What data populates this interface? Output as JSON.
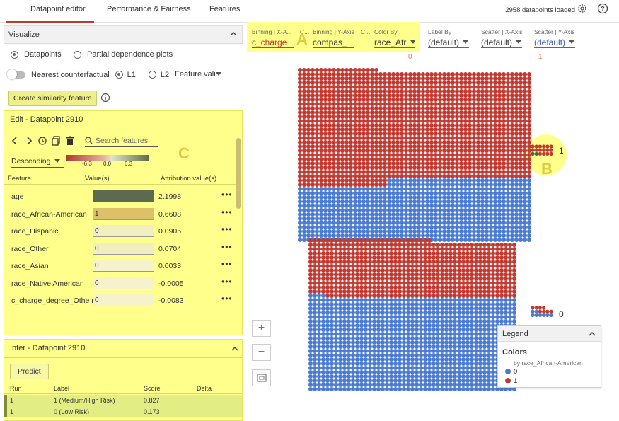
{
  "tabs": [
    {
      "label": "Datapoint editor"
    },
    {
      "label": "Performance & Fairness"
    },
    {
      "label": "Features"
    }
  ],
  "datapoints_loaded": "2958 datapoints loaded",
  "visualize": {
    "title": "Visualize",
    "datapoints_label": "Datapoints",
    "pdp_label": "Partial dependence plots",
    "nearest_cf_label": "Nearest counterfactual",
    "l1_label": "L1",
    "l2_label": "L2",
    "feature_select_value": "Feature valu",
    "create_button": "Create similarity feature"
  },
  "edit": {
    "title": "Edit - Datapoint 2910",
    "search_placeholder": "Search features",
    "sort_value": "Descending",
    "scale_labels": [
      "-6.3",
      "0.0",
      "6.3"
    ],
    "col_feature": "Feature",
    "col_values": "Value(s)",
    "col_attribution": "Attribution value(s)",
    "rows": [
      {
        "name": "age",
        "value": "",
        "attr": "2.1998",
        "bar": 1.0,
        "barcolor": "#5c6b4e"
      },
      {
        "name": "race_African-American",
        "value": "1",
        "attr": "0.6608",
        "bar": 1.0,
        "barcolor": "#dcc06a"
      },
      {
        "name": "race_Hispanic",
        "value": "0",
        "attr": "0.0905",
        "bar": 1.0,
        "barcolor": "#f3eec0"
      },
      {
        "name": "race_Other",
        "value": "0",
        "attr": "0.0704",
        "bar": 1.0,
        "barcolor": "#f3eec0"
      },
      {
        "name": "race_Asian",
        "value": "0",
        "attr": "0.0033",
        "bar": 1.0,
        "barcolor": "#f6f2cc"
      },
      {
        "name": "race_Native American",
        "value": "0",
        "attr": "-0.0005",
        "bar": 1.0,
        "barcolor": "#f6f2cc"
      },
      {
        "name": "c_charge_degree_Othe r",
        "value": "0",
        "attr": "-0.0083",
        "bar": 1.0,
        "barcolor": "#f6f2cc"
      }
    ],
    "more_glyph": "•••"
  },
  "infer": {
    "title": "Infer - Datapoint 2910",
    "predict_button": "Predict",
    "columns": [
      "Run",
      "Label",
      "Score",
      "Delta"
    ],
    "rows": [
      {
        "run": "1",
        "label": "1 (Medium/High Risk)",
        "score": "0.827",
        "delta": ""
      },
      {
        "run": "1",
        "label": "0 (Low Risk)",
        "score": "0.173",
        "delta": ""
      }
    ]
  },
  "axes": {
    "binning_x": {
      "label": "Binning | X-A...",
      "value": "c_charge"
    },
    "c1": {
      "label": "C..."
    },
    "binning_y": {
      "label": "Binning | Y-Axis",
      "value": "compas_"
    },
    "c2": {
      "label": "C..."
    },
    "color_by": {
      "label": "Color By",
      "value": "race_Afr"
    },
    "label_by": {
      "label": "Label By",
      "value": "(default)"
    },
    "scatter_x": {
      "label": "Scatter | X-Axis",
      "value": "(default)"
    },
    "scatter_y": {
      "label": "Scatter | Y-Axis",
      "value": "(default)"
    }
  },
  "markers": {
    "a": "A",
    "b": "B",
    "c": "C",
    "sort_zero": "0",
    "sort_one": "1"
  },
  "bins": {
    "label_1": "1",
    "label_0": "0"
  },
  "legend": {
    "title": "Legend",
    "colors_title": "Colors",
    "by_label": "by race_African-American",
    "items": [
      {
        "label": "0",
        "color": "#4a7bd0"
      },
      {
        "label": "1",
        "color": "#c03a32"
      }
    ]
  },
  "colors": {
    "red": "#c03a32",
    "blue": "#4a7bd0",
    "highlight": "#ffff8c",
    "accent": "#c0392b"
  }
}
